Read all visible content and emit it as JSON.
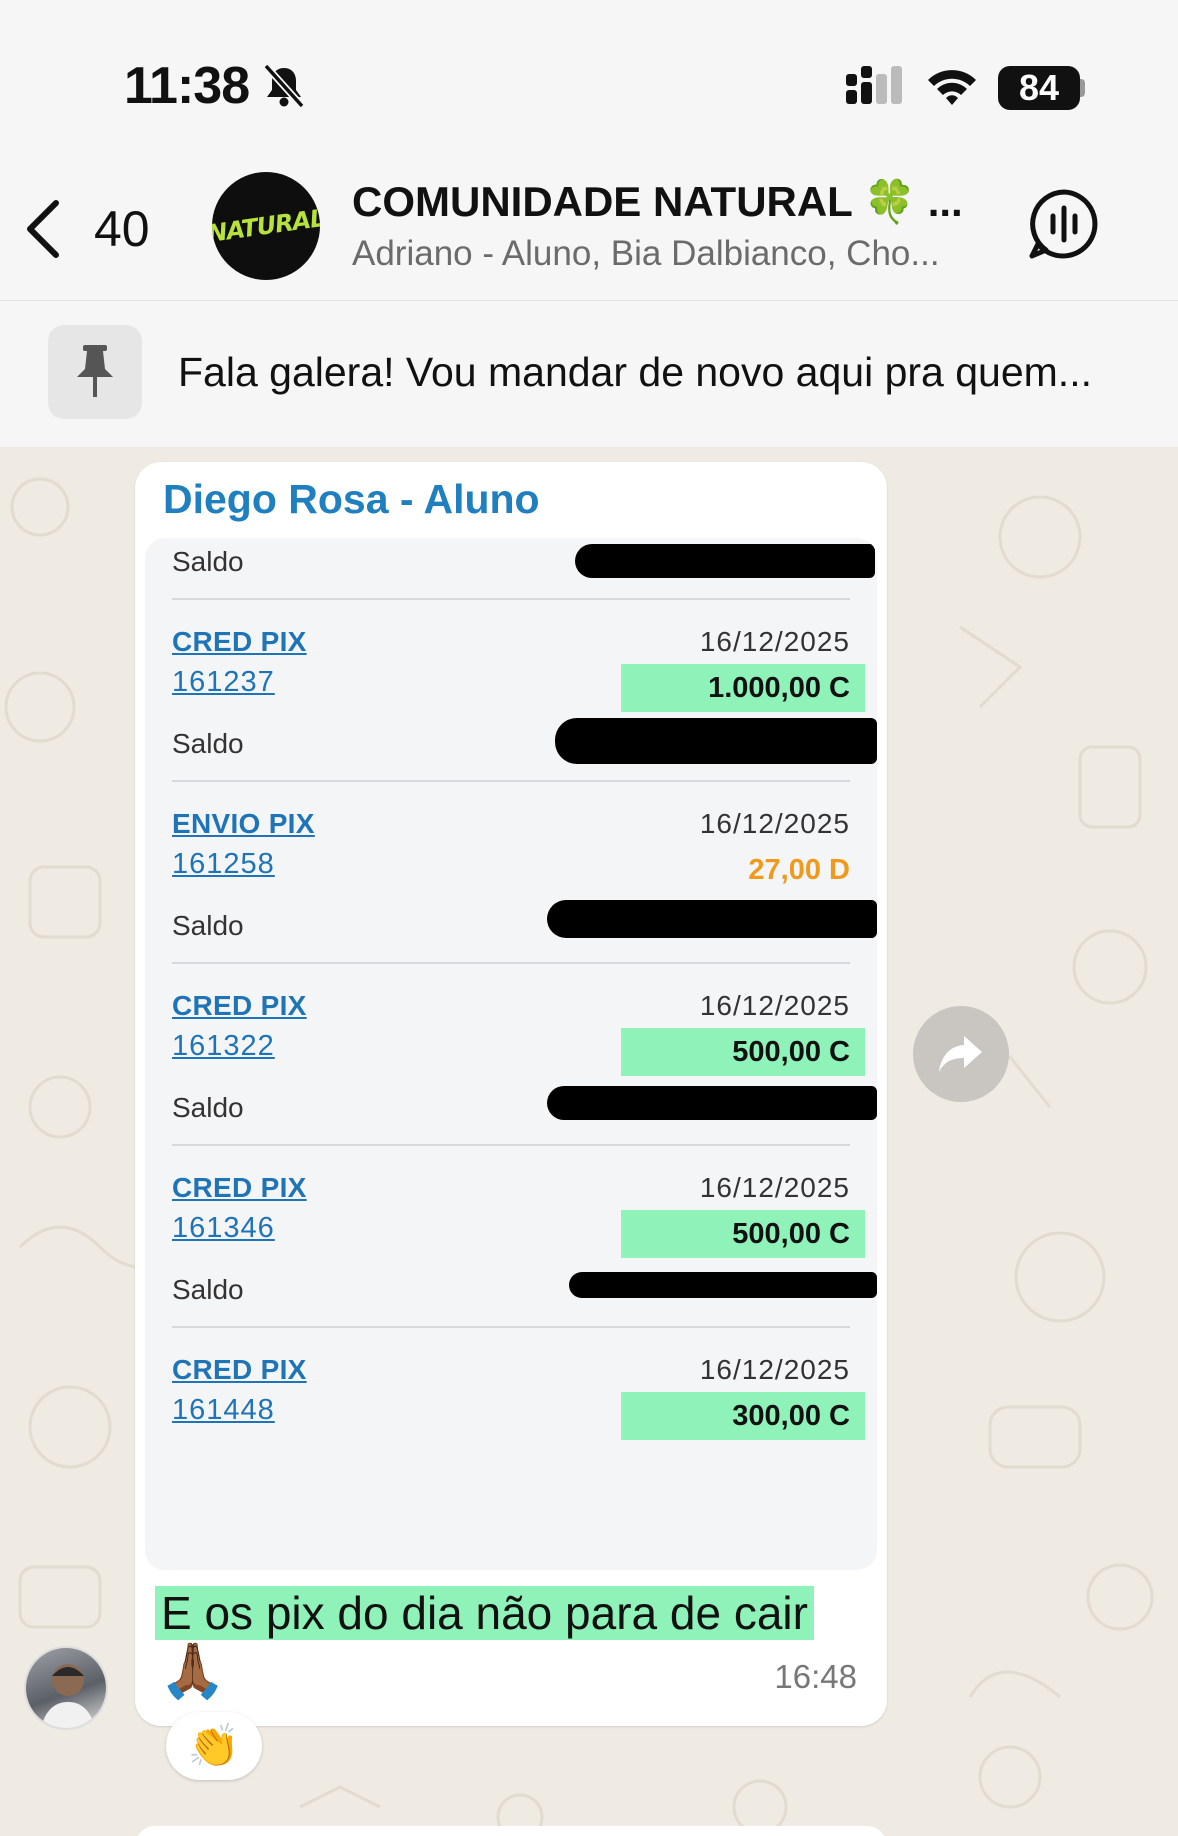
{
  "status_bar": {
    "time": "11:38",
    "battery": "84"
  },
  "header": {
    "back_count": "40",
    "group_name": "COMUNIDADE NATURAL 🍀 ...",
    "members": "Adriano - Aluno, Bia Dalbianco, Cho...",
    "avatar_text": "NATURAL"
  },
  "pinned": {
    "text": "Fala galera! Vou mandar de novo aqui pra quem..."
  },
  "message": {
    "sender": "Diego Rosa - Aluno",
    "caption": "E os pix do dia não para de cair",
    "emoji": "🙏🏾",
    "time": "16:48",
    "reaction": "👏",
    "statement": {
      "saldo_label": "Saldo",
      "transactions": [
        {
          "type": "CRED PIX",
          "id": "161237",
          "date": "16/12/2025",
          "amount": "1.000,00 C",
          "kind": "credit"
        },
        {
          "type": "ENVIO PIX",
          "id": "161258",
          "date": "16/12/2025",
          "amount": "27,00 D",
          "kind": "debit"
        },
        {
          "type": "CRED PIX",
          "id": "161322",
          "date": "16/12/2025",
          "amount": "500,00 C",
          "kind": "credit"
        },
        {
          "type": "CRED PIX",
          "id": "161346",
          "date": "16/12/2025",
          "amount": "500,00 C",
          "kind": "credit"
        },
        {
          "type": "CRED PIX",
          "id": "161448",
          "date": "16/12/2025",
          "amount": "300,00 C",
          "kind": "credit"
        }
      ]
    }
  },
  "colors": {
    "sender": "#1f7fbf",
    "link": "#1f73b7",
    "credit_highlight": "#8ef2b9",
    "debit": "#f09a1c",
    "chat_bg": "#efeae2"
  }
}
